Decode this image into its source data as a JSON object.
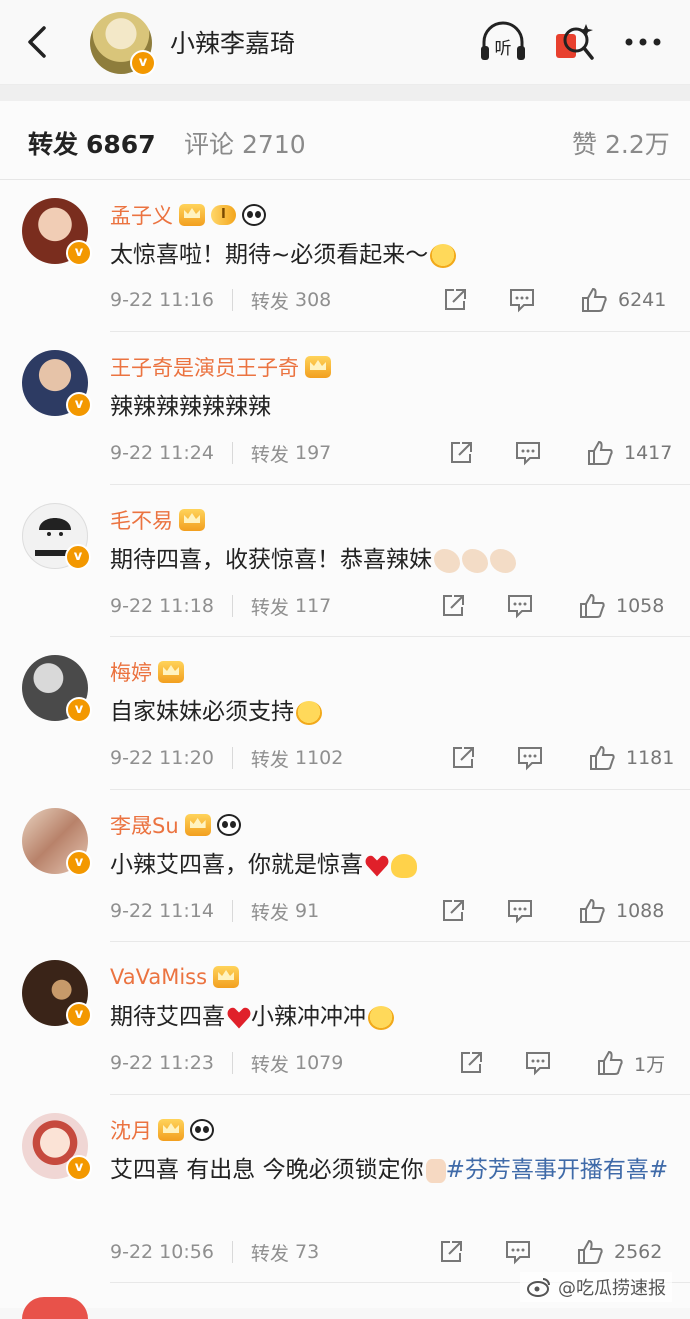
{
  "header": {
    "title": "小辣李嘉琦",
    "listen_label": "听",
    "badge": "v"
  },
  "tabs": [
    {
      "label": "转发",
      "count": "6867",
      "active": true
    },
    {
      "label": "评论",
      "count": "2710",
      "active": false
    },
    {
      "label": "赞",
      "count": "2.2万",
      "active": false
    }
  ],
  "comments": [
    {
      "user": "孟子义",
      "level": "I",
      "text": "太惊喜啦！期待~必须看起来～",
      "emoji": [
        "face"
      ],
      "time": "9-22 11:16",
      "repost_label": "转发",
      "reposts": "308",
      "likes": "6241",
      "avatar_color": "#7a2d1e"
    },
    {
      "user": "王子奇是演员王子奇",
      "text": "辣辣辣辣辣辣辣",
      "emoji": [],
      "time": "9-22 11:24",
      "repost_label": "转发",
      "reposts": "197",
      "likes": "1417",
      "avatar_color": "#2d3b63"
    },
    {
      "user": "毛不易",
      "text": "期待四喜，收获惊喜！恭喜辣妹",
      "emoji": [
        "clap",
        "clap",
        "clap"
      ],
      "time": "9-22 11:18",
      "repost_label": "转发",
      "reposts": "117",
      "likes": "1058",
      "avatar_color": "#e9e9e9"
    },
    {
      "user": "梅婷",
      "text": "自家妹妹必须支持",
      "emoji": [
        "face"
      ],
      "time": "9-22 11:20",
      "repost_label": "转发",
      "reposts": "1102",
      "likes": "1181",
      "avatar_color": "#4a4a4a"
    },
    {
      "user": "李晟Su",
      "text": "小辣艾四喜，你就是惊喜",
      "emoji": [
        "heart",
        "chick"
      ],
      "time": "9-22 11:14",
      "repost_label": "转发",
      "reposts": "91",
      "likes": "1088",
      "avatar_color": "#c9a489"
    },
    {
      "user": "VaVaMiss",
      "text_a": "期待艾四喜",
      "text_b": "小辣冲冲冲",
      "emoji": [
        "face"
      ],
      "time": "9-22 11:23",
      "repost_label": "转发",
      "reposts": "1079",
      "likes": "1万",
      "avatar_color": "#3a2418"
    },
    {
      "user": "沈月",
      "text": "艾四喜 有出息 今晚必须锁定你",
      "tag": "#芬芳喜事开播有喜#",
      "time": "9-22 10:56",
      "repost_label": "转发",
      "reposts": "73",
      "likes": "2562",
      "avatar_color": "#f0d6d4"
    }
  ],
  "watermark": "@吃瓜捞速报",
  "colors": {
    "username": "#eb7340",
    "topic": "#3f6aa8",
    "verified": "#f39800"
  },
  "icons": [
    "back-arrow-icon",
    "listen-icon",
    "magic-search-icon",
    "more-icon",
    "share-icon",
    "comment-icon",
    "like-icon",
    "crown-icon",
    "panda-icon"
  ]
}
